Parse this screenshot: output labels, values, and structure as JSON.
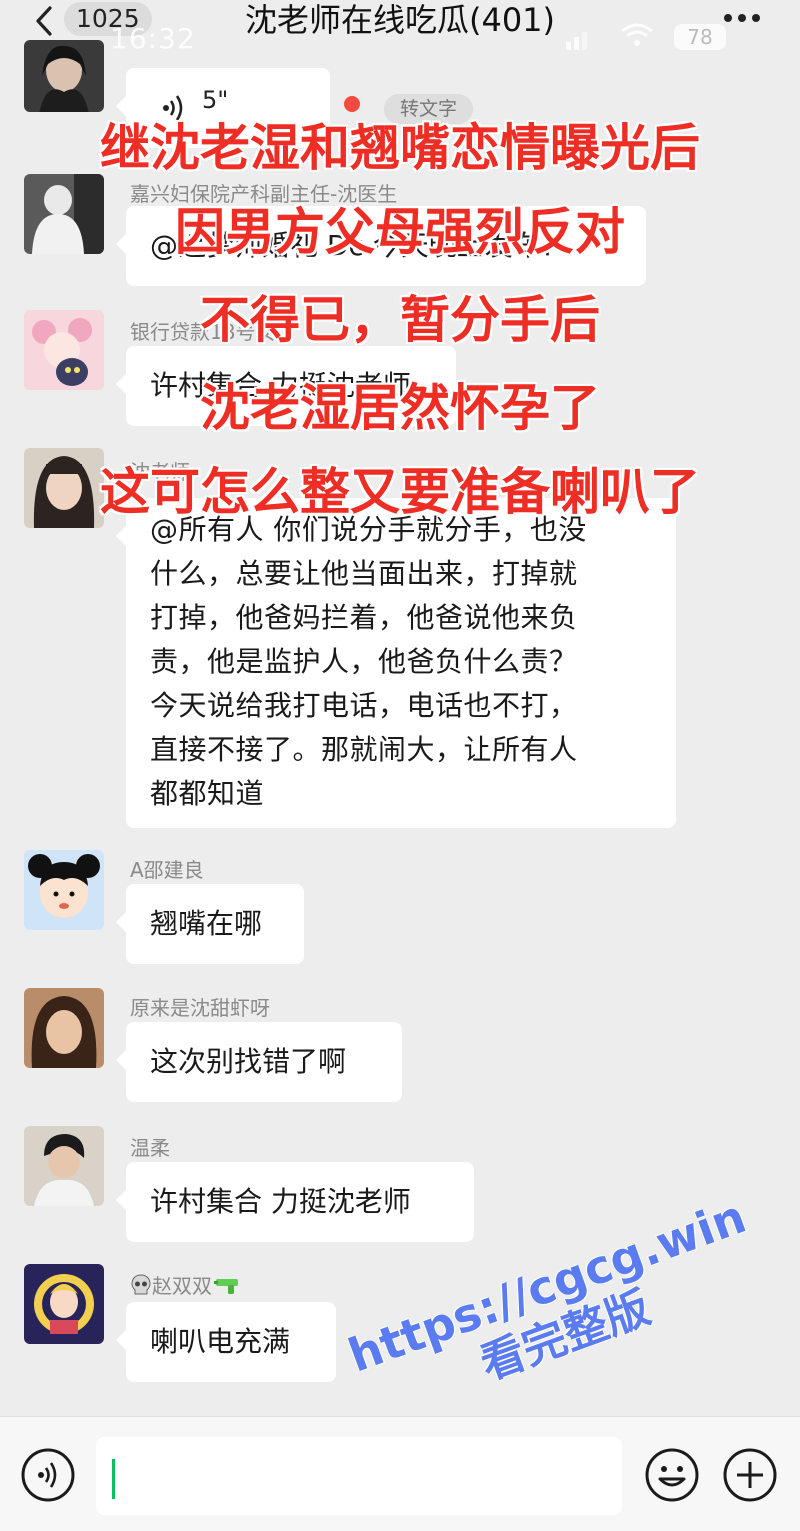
{
  "header": {
    "unread_count": "1025",
    "status_time": "16:32",
    "title": "沈老师在线吃瓜(401)",
    "battery": "78",
    "back_icon": "chevron-left-icon",
    "more_icon": "more-dots-icon"
  },
  "messages": [
    {
      "sender": "",
      "type": "voice",
      "duration": "5\"",
      "transcribe_label": "转文字"
    },
    {
      "sender": "嘉兴妇保院产科副主任-沈医生",
      "type": "text",
      "text": "@追梦师婚礼 Dc 今天晚上发车?"
    },
    {
      "sender": "银行贷款18号女",
      "type": "text",
      "text": "许村集合 力挺沈老师"
    },
    {
      "sender": "沈老师",
      "type": "text",
      "lines": [
        "@所有人  你们说分手就分手，也没",
        "什么，总要让他当面出来，打掉就",
        "打掉，他爸妈拦着，他爸说他来负",
        "责，他是监护人，他爸负什么责？",
        "今天说给我打电话，电话也不打，",
        "直接不接了。那就闹大，让所有人",
        "都都知道"
      ]
    },
    {
      "sender": "A邵建良",
      "type": "text",
      "text": "翘嘴在哪"
    },
    {
      "sender": "原来是沈甜虾呀",
      "type": "text",
      "text": "这次别找错了啊"
    },
    {
      "sender": "温柔",
      "type": "text",
      "text": "许村集合 力挺沈老师"
    },
    {
      "sender": "赵双双",
      "sender_prefix_icon": "skull-emoji-icon",
      "sender_suffix_icon": "water-gun-emoji-icon",
      "type": "text",
      "text": "喇叭电充满"
    }
  ],
  "overlay_caption": [
    "继沈老湿和翘嘴恋情曝光后",
    "因男方父母强烈反对",
    "不得已，暂分手后",
    "沈老湿居然怀孕了",
    "这可怎么整又要准备喇叭了"
  ],
  "watermark": {
    "url": "https://cgcg.win",
    "subtitle": "看完整版"
  },
  "input_bar": {
    "voice_icon": "voice-toggle-icon",
    "emoji_icon": "emoji-icon",
    "plus_icon": "plus-circle-icon"
  },
  "colors": {
    "overlay_text": "#ee2d25",
    "watermark": "#5b7cf0",
    "caret": "#07c160",
    "background": "#ededed"
  }
}
